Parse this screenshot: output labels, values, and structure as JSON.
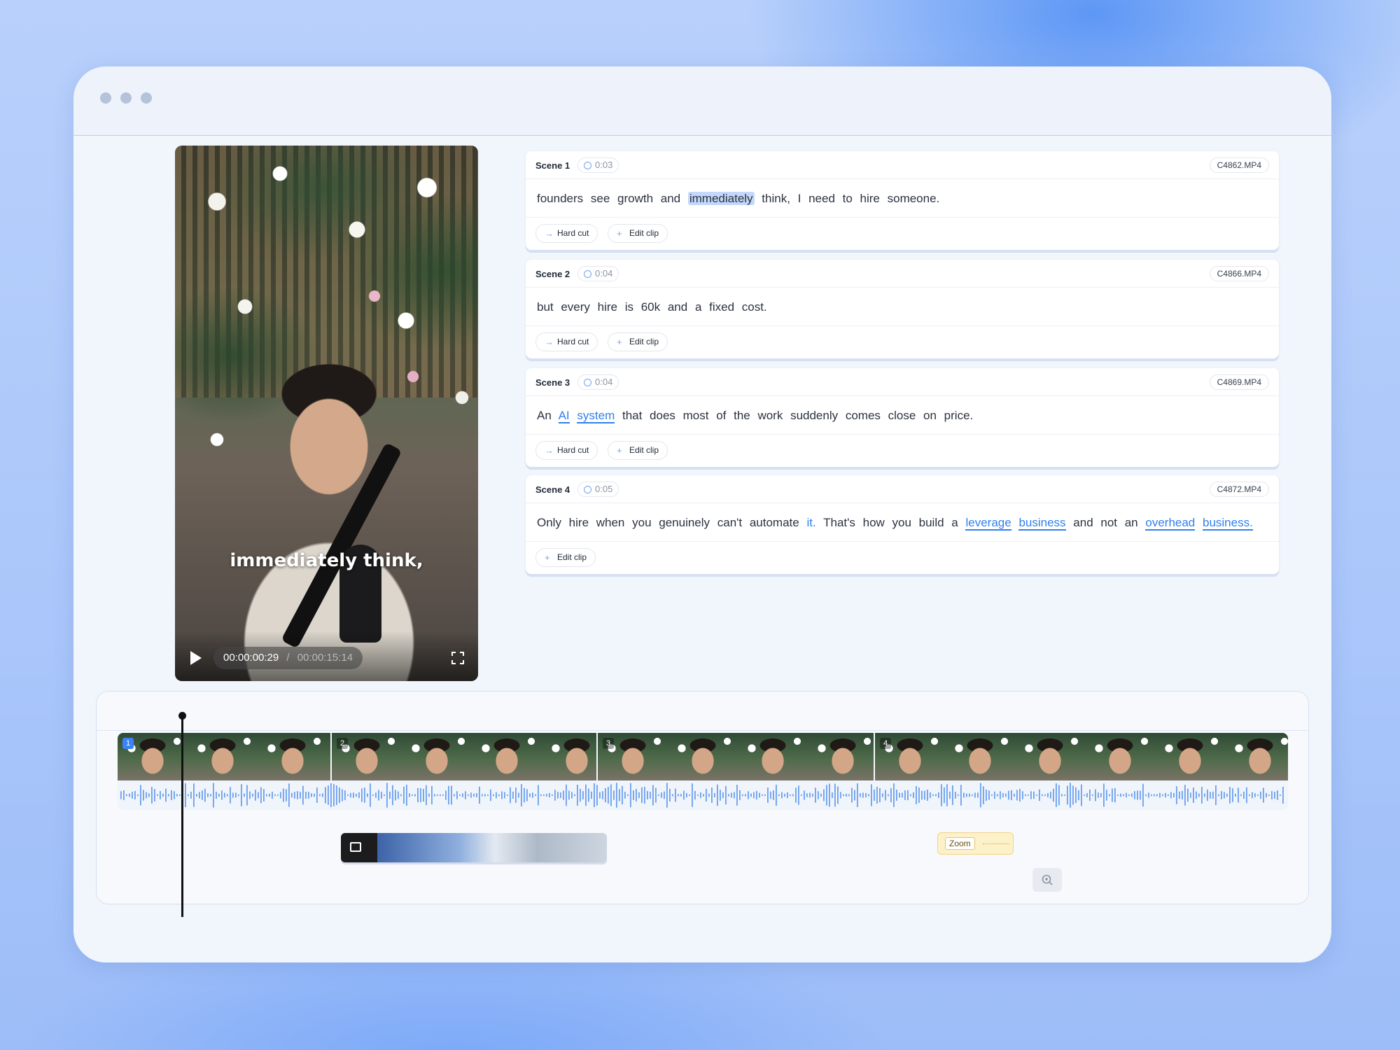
{
  "window": {
    "dots": [
      "window-dot-1",
      "window-dot-2",
      "window-dot-3"
    ]
  },
  "video": {
    "caption": "immediately think,",
    "current_time": "00:00:00:29",
    "separator": "/",
    "total_time": "00:00:15:14",
    "icons": {
      "play": "play-icon",
      "fullscreen": "fullscreen-icon"
    }
  },
  "scenes": [
    {
      "title": "Scene 1",
      "duration": "0:03",
      "file": "C4862.MP4",
      "text": {
        "before": "founders see growth and",
        "highlight": "immediately",
        "after": "think, I need to hire someone."
      },
      "actions": [
        "Hard cut",
        "Edit clip"
      ]
    },
    {
      "title": "Scene 2",
      "duration": "0:04",
      "file": "C4866.MP4",
      "text": {
        "plain": "but every hire is 60k and a fixed cost."
      },
      "actions": [
        "Hard cut",
        "Edit clip"
      ]
    },
    {
      "title": "Scene 3",
      "duration": "0:04",
      "file": "C4869.MP4",
      "text": {
        "before": "An",
        "kw1": "AI",
        "kw2": "system",
        "after": "that does most of the work suddenly comes close on price."
      },
      "actions": [
        "Hard cut",
        "Edit clip"
      ]
    },
    {
      "title": "Scene 4",
      "duration": "0:05",
      "file": "C4872.MP4",
      "text": {
        "p1": "Only hire when you genuinely can't automate",
        "it": "it.",
        "p2": "That's how you build a",
        "kw1": "leverage",
        "kw2": "business",
        "p3": "and not an",
        "kw3": "overhead",
        "kw4": "business."
      },
      "actions": [
        "Edit clip"
      ]
    }
  ],
  "timeline": {
    "clips": [
      {
        "num": "1",
        "active": true
      },
      {
        "num": "2",
        "active": false
      },
      {
        "num": "3",
        "active": false
      },
      {
        "num": "4",
        "active": false
      }
    ],
    "zoom_label": "Zoom",
    "icons": {
      "broll": "b-roll-icon",
      "zoom_button": "zoom-in-icon"
    }
  },
  "colors": {
    "accent": "#2f80ed",
    "highlight": "#c3d8fb",
    "zoom_bg": "#fdf1c9",
    "active_clip": "#3b82f6"
  }
}
